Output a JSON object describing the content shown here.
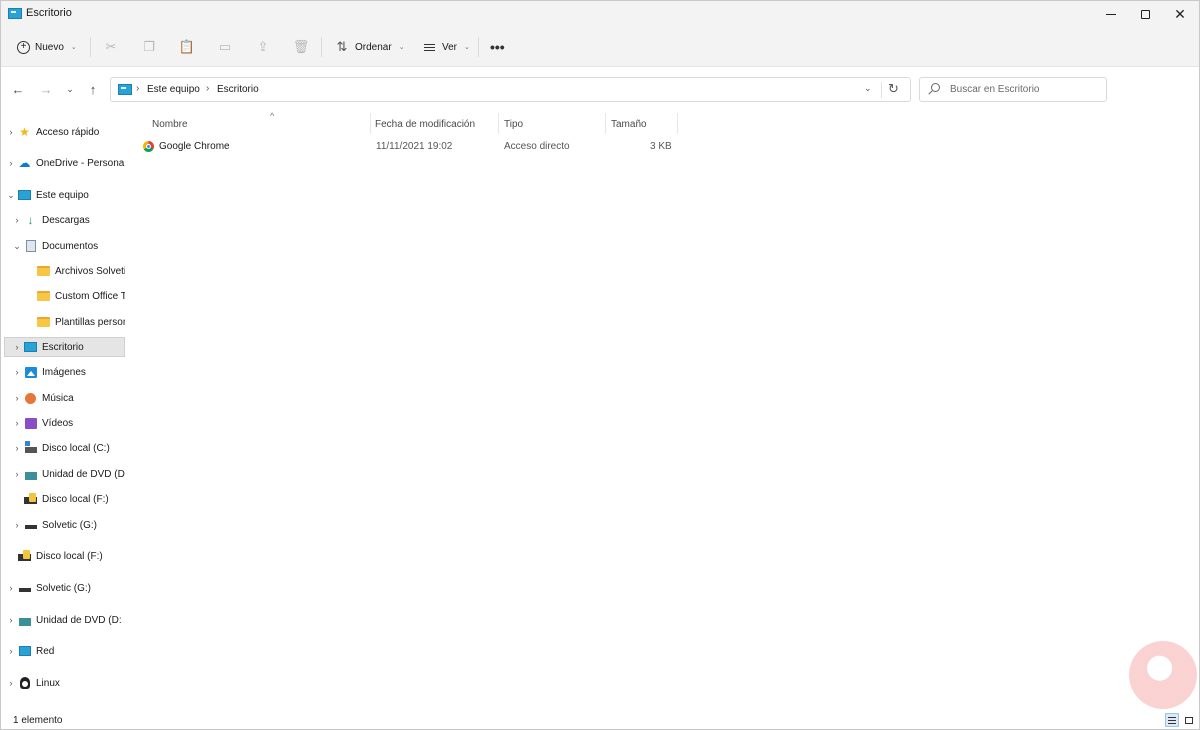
{
  "window": {
    "title": "Escritorio",
    "minimize_label": "—",
    "maximize_label": "□",
    "close_label": "✕"
  },
  "toolbar": {
    "new_label": "Nuevo",
    "sort_label": "Ordenar",
    "view_label": "Ver",
    "more_label": "•••",
    "icons": [
      "cut-icon",
      "copy-icon",
      "paste-icon",
      "rename-icon",
      "share-icon",
      "delete-icon"
    ]
  },
  "navigation": {
    "back": "←",
    "forward": "→",
    "recent": "⌄",
    "up": "↑"
  },
  "address": {
    "breadcrumbs": [
      "Este equipo",
      "Escritorio"
    ],
    "separator": "›",
    "dropdown": "⌄",
    "refresh": "↻"
  },
  "search": {
    "placeholder": "Buscar en Escritorio"
  },
  "sidebar": {
    "items": [
      {
        "label": "Acceso rápido",
        "icon": "star-icon",
        "chevron": "›"
      },
      {
        "label": "OneDrive - Persona",
        "icon": "cloud-icon",
        "chevron": "›"
      },
      {
        "label": "Este equipo",
        "icon": "computer-icon",
        "chevron": "⌄"
      },
      {
        "label": "Descargas",
        "icon": "download-icon",
        "chevron": "›"
      },
      {
        "label": "Documentos",
        "icon": "document-icon",
        "chevron": "⌄"
      },
      {
        "label": "Archivos Solvetic",
        "icon": "folder-icon",
        "chevron": ""
      },
      {
        "label": "Custom Office Te",
        "icon": "folder-icon",
        "chevron": ""
      },
      {
        "label": "Plantillas person",
        "icon": "folder-icon",
        "chevron": ""
      },
      {
        "label": "Escritorio",
        "icon": "desktop-icon",
        "chevron": "›"
      },
      {
        "label": "Imágenes",
        "icon": "pictures-icon",
        "chevron": "›"
      },
      {
        "label": "Música",
        "icon": "music-icon",
        "chevron": "›"
      },
      {
        "label": "Vídeos",
        "icon": "videos-icon",
        "chevron": "›"
      },
      {
        "label": "Disco local (C:)",
        "icon": "drive-icon",
        "chevron": "›"
      },
      {
        "label": "Unidad de DVD (D",
        "icon": "dvd-icon",
        "chevron": "›"
      },
      {
        "label": "Disco local (F:)",
        "icon": "usb-drive-icon",
        "chevron": ""
      },
      {
        "label": "Solvetic (G:)",
        "icon": "drive-icon",
        "chevron": "›"
      },
      {
        "label": "Disco local (F:)",
        "icon": "usb-drive-icon",
        "chevron": ""
      },
      {
        "label": "Solvetic (G:)",
        "icon": "drive-icon",
        "chevron": "›"
      },
      {
        "label": "Unidad de DVD (D:",
        "icon": "dvd-icon",
        "chevron": "›"
      },
      {
        "label": "Red",
        "icon": "network-icon",
        "chevron": "›"
      },
      {
        "label": "Linux",
        "icon": "linux-icon",
        "chevron": "›"
      }
    ]
  },
  "files": {
    "columns": [
      "Nombre",
      "Fecha de modificación",
      "Tipo",
      "Tamaño"
    ],
    "sort_indicator": "^",
    "rows": [
      {
        "name": "Google Chrome",
        "modified": "11/11/2021 19:02",
        "type": "Acceso directo",
        "size": "3 KB"
      }
    ]
  },
  "status": {
    "count_text": "1 elemento"
  },
  "colors": {
    "accent": "#0f78d4",
    "selection": "#e5e5e5",
    "toolbar_bg": "#f3f3f3"
  }
}
